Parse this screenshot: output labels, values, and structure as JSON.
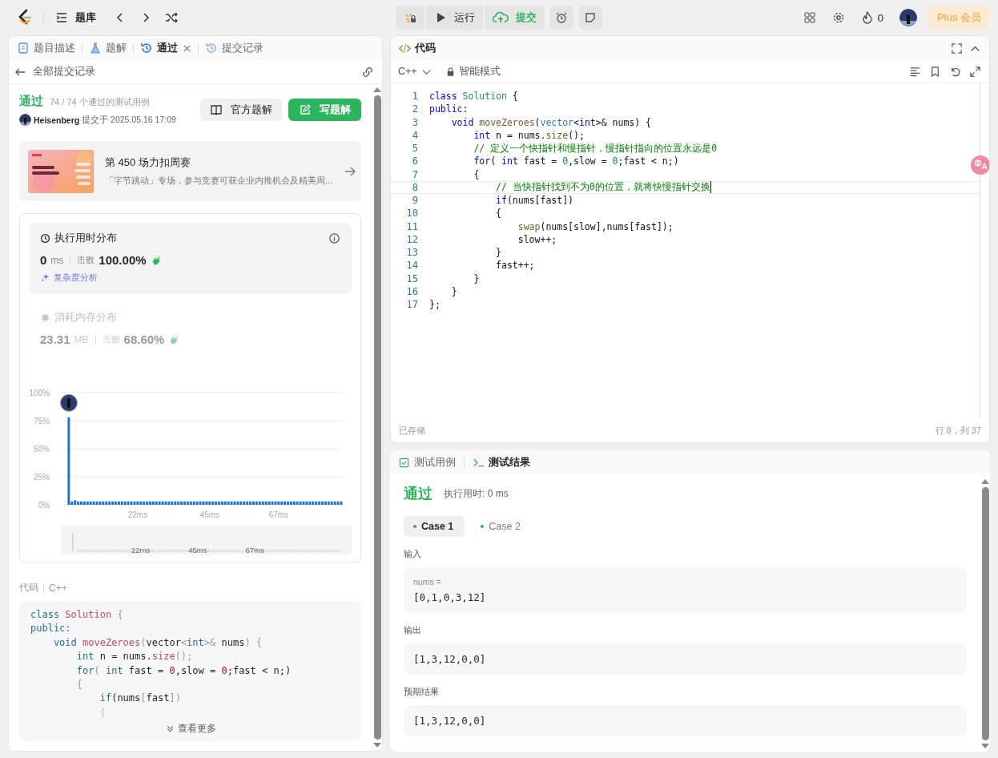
{
  "topbar": {
    "problem_list": "题库",
    "run": "运行",
    "submit": "提交",
    "streak": "0",
    "plus": "Plus 会员"
  },
  "left_tabs": [
    {
      "label": "题目描述",
      "selected": false,
      "closable": false
    },
    {
      "label": "题解",
      "selected": false,
      "closable": false
    },
    {
      "label": "通过",
      "selected": true,
      "closable": true
    },
    {
      "label": "提交记录",
      "selected": false,
      "closable": false
    }
  ],
  "submission": {
    "back": "全部提交记录",
    "status": "通过",
    "cases": "74 / 74 个通过的测试用例",
    "user": "Heisenberg",
    "submitted": "提交于 2025.05.16 17:09",
    "official_button": "官方题解",
    "write_button": "写题解"
  },
  "banner": {
    "title": "第 450 场力扣周赛",
    "desc": "「字节跳动」专场，参与竞赛可获企业内推机会及精美周..."
  },
  "metrics": [
    {
      "kind": "runtime",
      "title": "执行用时分布",
      "value": "0",
      "unit": "ms",
      "beats_label": "击败",
      "beats": "100.00%",
      "link": "复杂度分析",
      "selected": true
    },
    {
      "kind": "memory",
      "title": "消耗内存分布",
      "value": "23.31",
      "unit": "MB",
      "beats_label": "击败",
      "beats": "68.60%",
      "selected": false
    }
  ],
  "distribution": {
    "chart_data": {
      "type": "bar",
      "grid": true,
      "ylim": [
        0,
        100
      ],
      "yticks": [
        {
          "value": 0,
          "label": "0%"
        },
        {
          "value": 25,
          "label": "25%"
        },
        {
          "value": 50,
          "label": "50%"
        },
        {
          "value": 75,
          "label": "75%"
        },
        {
          "value": 100,
          "label": "100%"
        }
      ],
      "categories": [
        null,
        null,
        null,
        null,
        null,
        null,
        null,
        null,
        null,
        null,
        null,
        null,
        null,
        null,
        null,
        null,
        null,
        null,
        null,
        null,
        null,
        null,
        "22ms",
        null,
        null,
        null,
        null,
        null,
        null,
        null,
        null,
        null,
        null,
        null,
        null,
        null,
        null,
        null,
        null,
        null,
        null,
        null,
        null,
        null,
        null,
        "45ms",
        null,
        null,
        null,
        null,
        null,
        null,
        null,
        null,
        null,
        null,
        null,
        null,
        null,
        null,
        null,
        null,
        null,
        null,
        null,
        null,
        null,
        "67ms",
        null,
        null,
        null,
        null,
        null,
        null,
        null,
        null,
        null,
        null,
        null,
        null,
        null,
        null,
        null,
        null,
        null,
        null,
        null,
        null
      ],
      "values": [
        78,
        3,
        4,
        3,
        3,
        3,
        3,
        3,
        3,
        3,
        3,
        3,
        3,
        3,
        3,
        3,
        3,
        3,
        3,
        3,
        3,
        3,
        3,
        3,
        3,
        3,
        3,
        3,
        3,
        3,
        3,
        3,
        3,
        3,
        3,
        3,
        3,
        3,
        3,
        3,
        3,
        3,
        3,
        3,
        3,
        3,
        3,
        3,
        3,
        3,
        3,
        3,
        3,
        3,
        3,
        3,
        3,
        3,
        3,
        3,
        3,
        3,
        3,
        3,
        3,
        3,
        3,
        3,
        3,
        3,
        3,
        3,
        3,
        3,
        3,
        3,
        3,
        3,
        3,
        3,
        3,
        3,
        3,
        3,
        3,
        3,
        3,
        3
      ]
    },
    "navigator_labels": [
      "22ms",
      "45ms",
      "67ms"
    ]
  },
  "code_preview": {
    "label": "代码",
    "language": "C++",
    "more": "查看更多",
    "lines": [
      {
        "tokens": [
          {
            "text": "class",
            "kind": "kw"
          },
          {
            "text": " Solution",
            "kind": "ty"
          },
          {
            "text": " {",
            "kind": "pn"
          }
        ]
      },
      {
        "tokens": [
          {
            "text": "public:",
            "kind": "kw"
          }
        ]
      },
      {
        "tokens": [
          {
            "text": "    void",
            "kind": "kw"
          },
          {
            "text": " moveZeroes",
            "kind": "fn"
          },
          {
            "text": "(",
            "kind": "pn"
          },
          {
            "text": "vector",
            "kind": "pl"
          },
          {
            "text": "<",
            "kind": "pn"
          },
          {
            "text": "int",
            "kind": "kw"
          },
          {
            "text": ">&",
            "kind": "pn"
          },
          {
            "text": " nums",
            "kind": "pl"
          },
          {
            "text": ") {",
            "kind": "pn"
          }
        ]
      },
      {
        "tokens": [
          {
            "text": "        int",
            "kind": "kw"
          },
          {
            "text": " n = nums.",
            "kind": "pl"
          },
          {
            "text": "size",
            "kind": "fn"
          },
          {
            "text": "();",
            "kind": "pn"
          }
        ]
      },
      {
        "tokens": [
          {
            "text": "        for",
            "kind": "kw"
          },
          {
            "text": "( ",
            "kind": "pn"
          },
          {
            "text": "int",
            "kind": "kw"
          },
          {
            "text": " fast = ",
            "kind": "pl"
          },
          {
            "text": "0",
            "kind": "nm"
          },
          {
            "text": ",slow = ",
            "kind": "pl"
          },
          {
            "text": "0",
            "kind": "nm"
          },
          {
            "text": ";fast < n;)",
            "kind": "pl"
          }
        ]
      },
      {
        "tokens": [
          {
            "text": "        {",
            "kind": "pn"
          }
        ]
      },
      {
        "tokens": [
          {
            "text": "            if",
            "kind": "kw"
          },
          {
            "text": "(nums",
            "kind": "pl"
          },
          {
            "text": "[",
            "kind": "pn"
          },
          {
            "text": "fast",
            "kind": "pl"
          },
          {
            "text": "])",
            "kind": "pn"
          }
        ]
      },
      {
        "tokens": [
          {
            "text": "            {",
            "kind": "pn"
          }
        ]
      }
    ]
  },
  "editor": {
    "title": "代码",
    "language": "C++",
    "mode": "智能模式",
    "saved": "已存储",
    "position": "行 8，列 37",
    "lines": [
      {
        "number": "1",
        "current": false,
        "tokens": [
          {
            "text": "class",
            "kind": "kw"
          },
          {
            "text": " Solution",
            "kind": "ty"
          },
          {
            "text": " {",
            "kind": "pl"
          }
        ]
      },
      {
        "number": "2",
        "current": false,
        "tokens": [
          {
            "text": "public:",
            "kind": "kw"
          }
        ]
      },
      {
        "number": "3",
        "current": false,
        "tokens": [
          {
            "text": "    void",
            "kind": "kw"
          },
          {
            "text": " moveZeroes",
            "kind": "fn"
          },
          {
            "text": "(",
            "kind": "pl"
          },
          {
            "text": "vector",
            "kind": "ty"
          },
          {
            "text": "<",
            "kind": "pl"
          },
          {
            "text": "int",
            "kind": "kw"
          },
          {
            "text": ">& nums) {",
            "kind": "pl"
          }
        ]
      },
      {
        "number": "4",
        "current": false,
        "tokens": [
          {
            "text": "        int",
            "kind": "kw"
          },
          {
            "text": " n = nums.",
            "kind": "pl"
          },
          {
            "text": "size",
            "kind": "fn"
          },
          {
            "text": "();",
            "kind": "pl"
          }
        ]
      },
      {
        "number": "5",
        "current": false,
        "tokens": [
          {
            "text": "        // 定义一个快指针和慢指针，慢指针指向的位置永远是0",
            "kind": "cm"
          }
        ]
      },
      {
        "number": "6",
        "current": false,
        "tokens": [
          {
            "text": "        for",
            "kind": "kw"
          },
          {
            "text": "( ",
            "kind": "pl"
          },
          {
            "text": "int",
            "kind": "kw"
          },
          {
            "text": " fast = ",
            "kind": "pl"
          },
          {
            "text": "0",
            "kind": "nm"
          },
          {
            "text": ",slow = ",
            "kind": "pl"
          },
          {
            "text": "0",
            "kind": "nm"
          },
          {
            "text": ";fast < n;)",
            "kind": "pl"
          }
        ]
      },
      {
        "number": "7",
        "current": false,
        "tokens": [
          {
            "text": "        {",
            "kind": "pl"
          }
        ]
      },
      {
        "number": "8",
        "current": true,
        "tokens": [
          {
            "text": "            // 当快指针找到不为0的位置，就将快慢指针交换",
            "kind": "cm"
          }
        ]
      },
      {
        "number": "9",
        "current": false,
        "tokens": [
          {
            "text": "            if",
            "kind": "kw"
          },
          {
            "text": "(nums[fast])",
            "kind": "pl"
          }
        ]
      },
      {
        "number": "10",
        "current": false,
        "tokens": [
          {
            "text": "            {",
            "kind": "pl"
          }
        ]
      },
      {
        "number": "11",
        "current": false,
        "tokens": [
          {
            "text": "                swap",
            "kind": "fn"
          },
          {
            "text": "(nums[slow],nums[fast]);",
            "kind": "pl"
          }
        ]
      },
      {
        "number": "12",
        "current": false,
        "tokens": [
          {
            "text": "                slow++;",
            "kind": "pl"
          }
        ]
      },
      {
        "number": "13",
        "current": false,
        "tokens": [
          {
            "text": "            }",
            "kind": "pl"
          }
        ]
      },
      {
        "number": "14",
        "current": false,
        "tokens": [
          {
            "text": "            fast++;",
            "kind": "pl"
          }
        ]
      },
      {
        "number": "15",
        "current": false,
        "tokens": [
          {
            "text": "        }",
            "kind": "pl"
          }
        ]
      },
      {
        "number": "16",
        "current": false,
        "tokens": [
          {
            "text": "    }",
            "kind": "pl"
          }
        ]
      },
      {
        "number": "17",
        "current": false,
        "tokens": [
          {
            "text": "};",
            "kind": "pl"
          }
        ]
      }
    ]
  },
  "tests": {
    "tabs": [
      {
        "label": "测试用例",
        "selected": false
      },
      {
        "label": "测试结果",
        "selected": true
      }
    ],
    "status": "通过",
    "runtime": "执行用时: 0 ms",
    "cases": [
      {
        "label": "Case 1",
        "selected": true
      },
      {
        "label": "Case 2",
        "selected": false
      }
    ],
    "sections": [
      {
        "label": "输入",
        "variable": "nums =",
        "value": "[0,1,0,3,12]"
      },
      {
        "label": "输出",
        "value": "[1,3,12,0,0]"
      },
      {
        "label": "预期结果",
        "value": "[1,3,12,0,0]"
      }
    ]
  }
}
